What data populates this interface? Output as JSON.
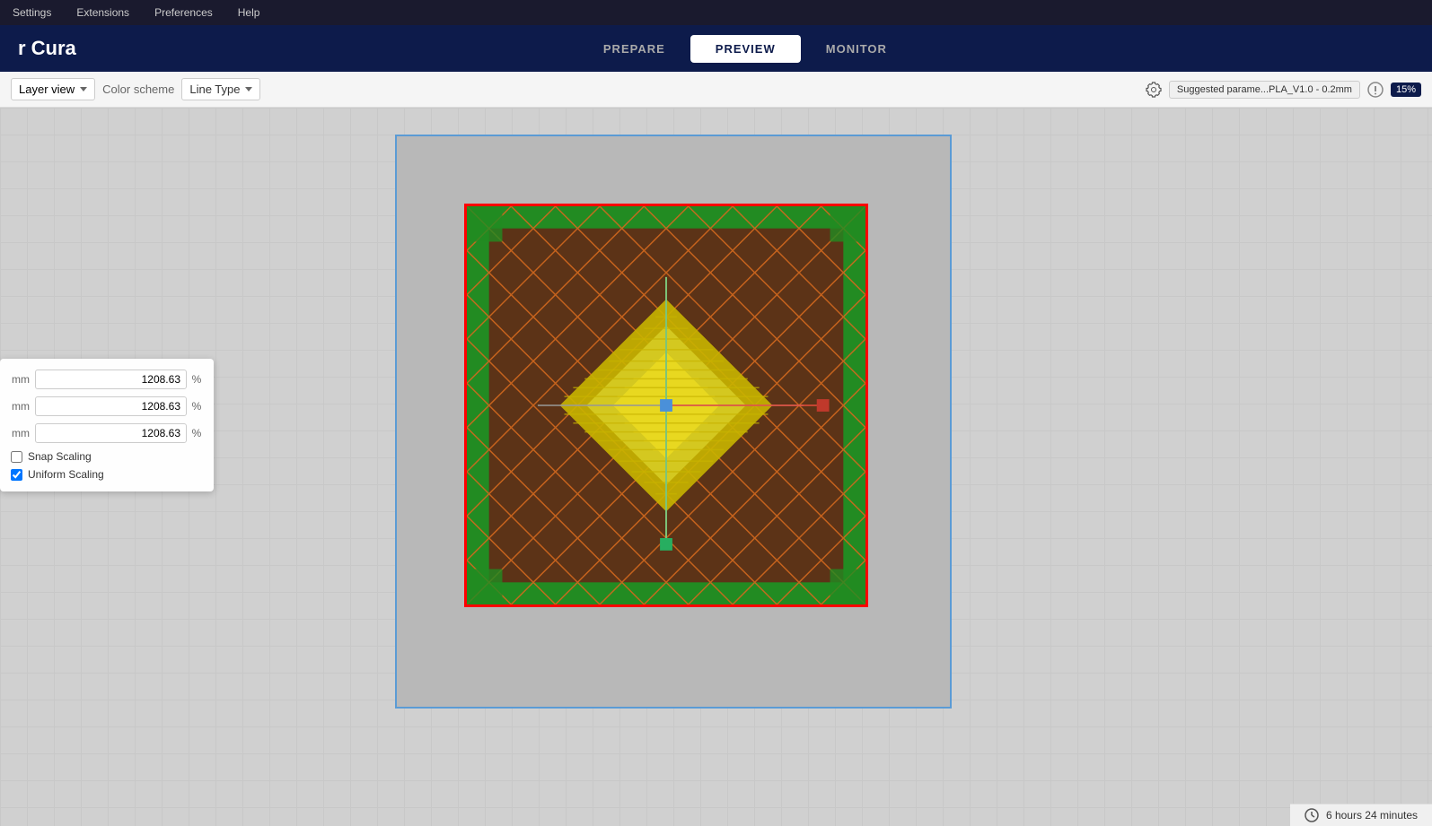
{
  "app": {
    "title": "r Cura"
  },
  "menu": {
    "items": [
      "Settings",
      "Extensions",
      "Preferences",
      "Help"
    ]
  },
  "nav": {
    "tabs": [
      "PREPARE",
      "PREVIEW",
      "MONITOR"
    ],
    "active": "PREVIEW"
  },
  "toolbar": {
    "view_label": "Layer view",
    "color_scheme_label": "Color scheme",
    "color_scheme_value": "Line Type",
    "suggested_params": "Suggested parame...PLA_V1.0 - 0.2mm",
    "percentage": "15%"
  },
  "scale_panel": {
    "x_label": "mm",
    "y_label": "mm",
    "z_label": "mm",
    "x_value": "1208.63",
    "y_value": "1208.63",
    "z_value": "1208.63",
    "x_unit": "%",
    "y_unit": "%",
    "z_unit": "%",
    "snap_scaling": "Snap Scaling",
    "uniform_scaling": "Uniform Scaling"
  },
  "status_bar": {
    "time_label": "6 hours 24 minutes"
  }
}
